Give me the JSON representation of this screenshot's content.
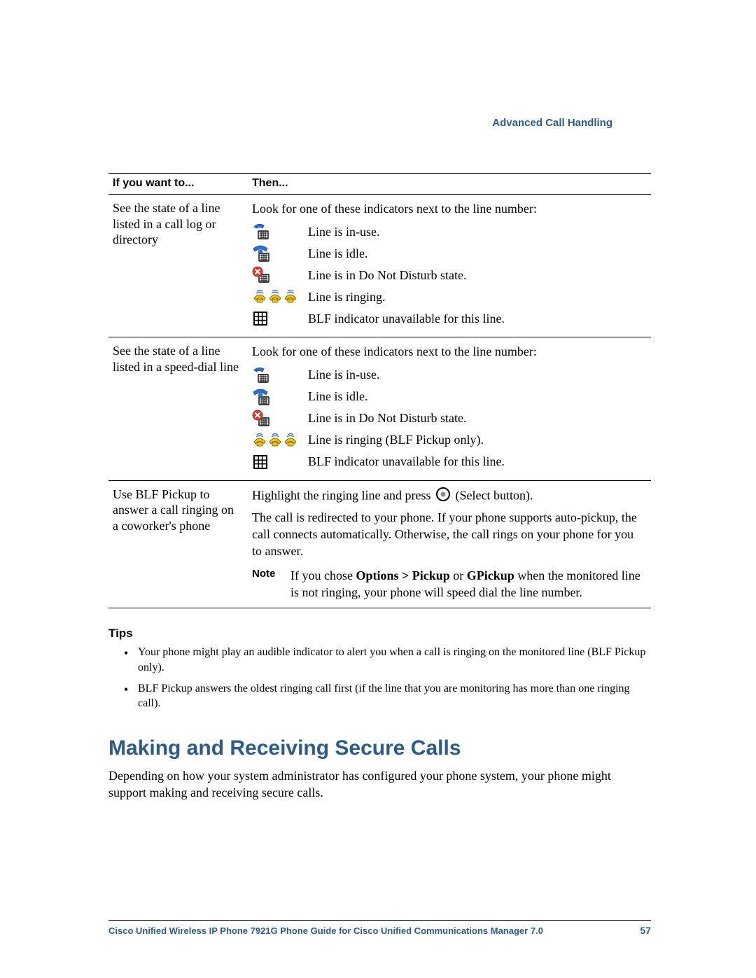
{
  "running_head": "Advanced Call Handling",
  "table": {
    "headers": {
      "col1": "If you want to...",
      "col2": "Then..."
    },
    "rows": [
      {
        "task": "See the state of a line listed in a call log or directory",
        "intro": "Look for one of these indicators next to the line number:",
        "indicators": [
          {
            "icon": "line-in-use-icon",
            "label": "Line is in-use."
          },
          {
            "icon": "line-idle-icon",
            "label": "Line is idle."
          },
          {
            "icon": "line-dnd-icon",
            "label": "Line is in Do Not Disturb state."
          },
          {
            "icon": "line-ringing-icon",
            "label": "Line is ringing."
          },
          {
            "icon": "blf-unavailable-icon",
            "label": "BLF indicator unavailable for this line."
          }
        ]
      },
      {
        "task": "See the state of a line listed in a speed-dial line",
        "intro": "Look for one of these indicators next to the line number:",
        "indicators": [
          {
            "icon": "line-in-use-icon",
            "label": "Line is in-use."
          },
          {
            "icon": "line-idle-icon",
            "label": "Line is idle."
          },
          {
            "icon": "line-dnd-icon",
            "label": "Line is in Do Not Disturb state."
          },
          {
            "icon": "line-ringing-icon",
            "label": "Line is ringing (BLF Pickup only)."
          },
          {
            "icon": "blf-unavailable-icon",
            "label": "BLF indicator unavailable for this line."
          }
        ]
      },
      {
        "task": "Use BLF Pickup to answer a call ringing on a coworker's phone",
        "highlight_pre": "Highlight the ringing line and press ",
        "highlight_post": " (Select button).",
        "body": "The call is redirected to your phone. If your phone supports auto-pickup, the call connects automatically. Otherwise, the call rings on your phone for you to answer.",
        "note_label": "Note",
        "note_pre": "If you chose ",
        "note_b1": "Options > Pickup",
        "note_mid": " or ",
        "note_b2": "GPickup",
        "note_post": " when the monitored line is not ringing, your phone will speed dial the line number."
      }
    ]
  },
  "tips_head": "Tips",
  "tips": [
    "Your phone might play an audible indicator to alert you when a call is ringing on the monitored line (BLF Pickup only).",
    "BLF Pickup answers the oldest ringing call first (if the line that you are monitoring has more than one ringing call)."
  ],
  "section_heading": "Making and Receiving Secure Calls",
  "section_body": "Depending on how your system administrator has configured your phone system, your phone might support making and receiving secure calls.",
  "footer": {
    "doc_title": "Cisco Unified Wireless IP Phone 7921G Phone Guide for Cisco Unified Communications Manager 7.0",
    "page_num": "57"
  }
}
